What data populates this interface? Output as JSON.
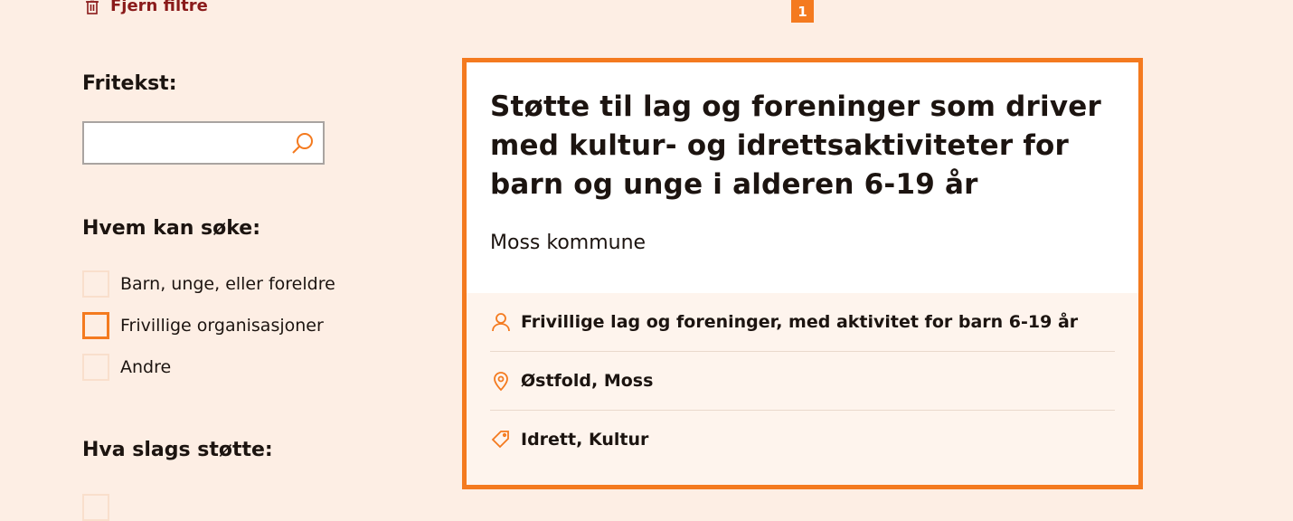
{
  "filters": {
    "clear_label": "Fjern filtre",
    "freetext_title": "Fritekst:",
    "search_value": "",
    "who_title": "Hvem kan søke:",
    "who_options": [
      {
        "label": "Barn, unge, eller foreldre",
        "checked": false
      },
      {
        "label": "Frivillige organisasjoner",
        "checked": false
      },
      {
        "label": "Andre",
        "checked": false
      }
    ],
    "support_title": "Hva slags støtte:"
  },
  "pagination": {
    "current": "1"
  },
  "card": {
    "title": "Støtte til lag og foreninger som driver med kultur- og idrettsaktiviteter for barn og unge i alderen 6-19 år",
    "organization": "Moss kommune",
    "audience": "Frivillige lag og foreninger, med aktivitet for barn 6-19 år",
    "locations": [
      "Østfold",
      "Moss"
    ],
    "tags": [
      "Idrett",
      "Kultur"
    ]
  },
  "colors": {
    "accent": "#f47a1f",
    "background": "#fdeee4",
    "link": "#8a1a1a"
  }
}
